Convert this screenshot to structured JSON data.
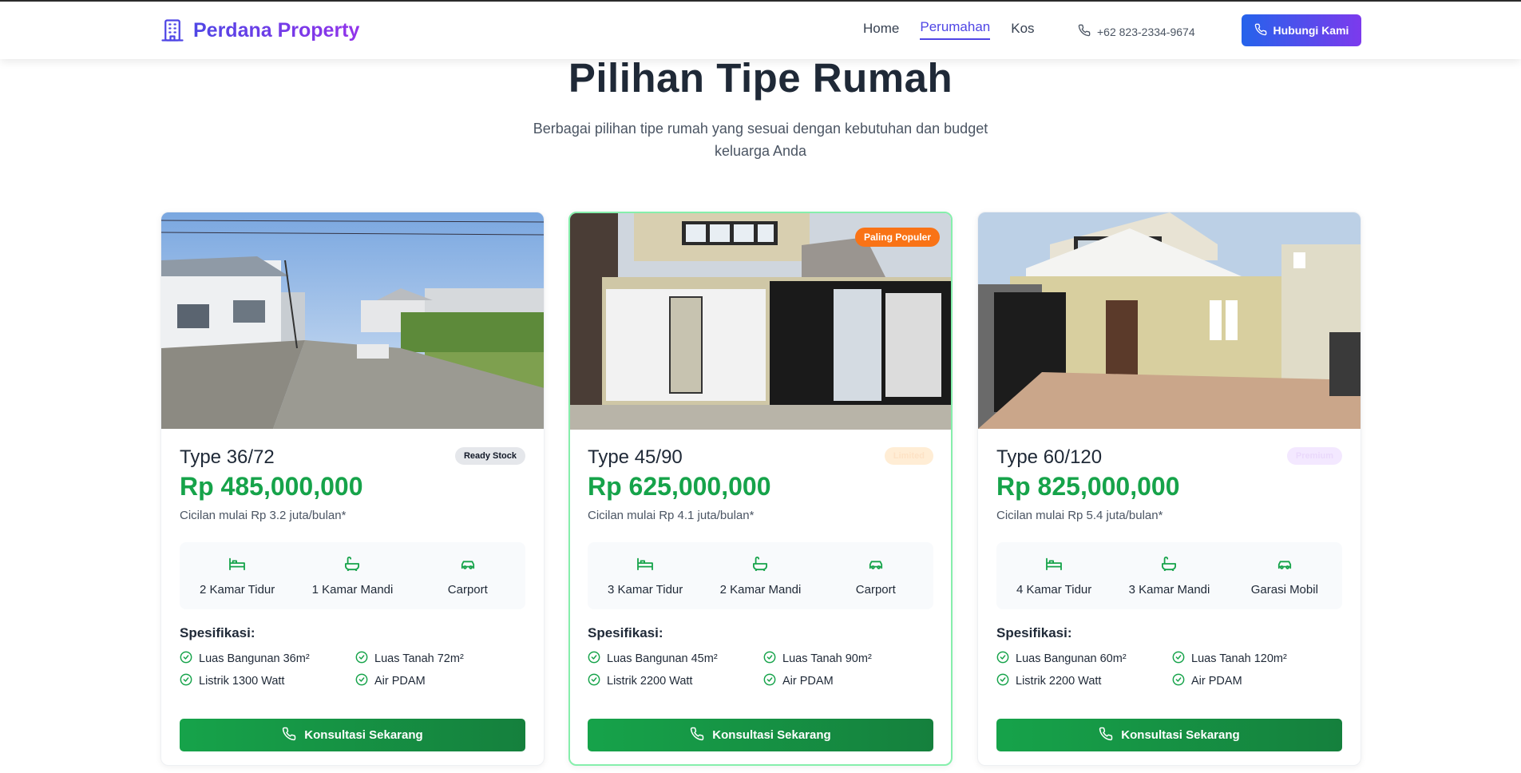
{
  "header": {
    "brand_name": "Perdana Property",
    "nav": [
      {
        "label": "Home"
      },
      {
        "label": "Perumahan"
      },
      {
        "label": "Kos"
      }
    ],
    "phone": "+62 823-2334-9674",
    "cta_label": "Hubungi Kami"
  },
  "section": {
    "title": "Pilihan Tipe Rumah",
    "subtitle": "Berbagai pilihan tipe rumah yang sesuai dengan kebutuhan dan budget keluarga Anda"
  },
  "spec_heading": "Spesifikasi:",
  "consult_label": "Konsultasi Sekarang",
  "cards": [
    {
      "title": "Type 36/72",
      "status": "Ready Stock",
      "price": "Rp 485,000,000",
      "installment": "Cicilan mulai Rp 3.2 juta/bulan*",
      "features": [
        "2 Kamar Tidur",
        "1 Kamar Mandi",
        "Carport"
      ],
      "specs": [
        "Luas Bangunan 36m²",
        "Luas Tanah 72m²",
        "Listrik 1300 Watt",
        "Air PDAM"
      ]
    },
    {
      "title": "Type 45/90",
      "status": "Limited",
      "badge": "Paling Populer",
      "price": "Rp 625,000,000",
      "installment": "Cicilan mulai Rp 4.1 juta/bulan*",
      "features": [
        "3 Kamar Tidur",
        "2 Kamar Mandi",
        "Carport"
      ],
      "specs": [
        "Luas Bangunan 45m²",
        "Luas Tanah 90m²",
        "Listrik 2200 Watt",
        "Air PDAM"
      ]
    },
    {
      "title": "Type 60/120",
      "status": "Premium",
      "price": "Rp 825,000,000",
      "installment": "Cicilan mulai Rp 5.4 juta/bulan*",
      "features": [
        "4 Kamar Tidur",
        "3 Kamar Mandi",
        "Garasi Mobil"
      ],
      "specs": [
        "Luas Bangunan 60m²",
        "Luas Tanah 120m²",
        "Listrik 2200 Watt",
        "Air PDAM"
      ]
    }
  ],
  "icons": {
    "brand": "building-icon",
    "phone": "phone-icon",
    "bed": "bed-icon",
    "bath": "bath-icon",
    "car": "car-icon",
    "check": "check-circle-icon"
  },
  "colors": {
    "brand_gradient_start": "#4f46e5",
    "brand_gradient_end": "#9333ea",
    "price_green": "#16a34a",
    "popular_orange": "#f97316"
  }
}
